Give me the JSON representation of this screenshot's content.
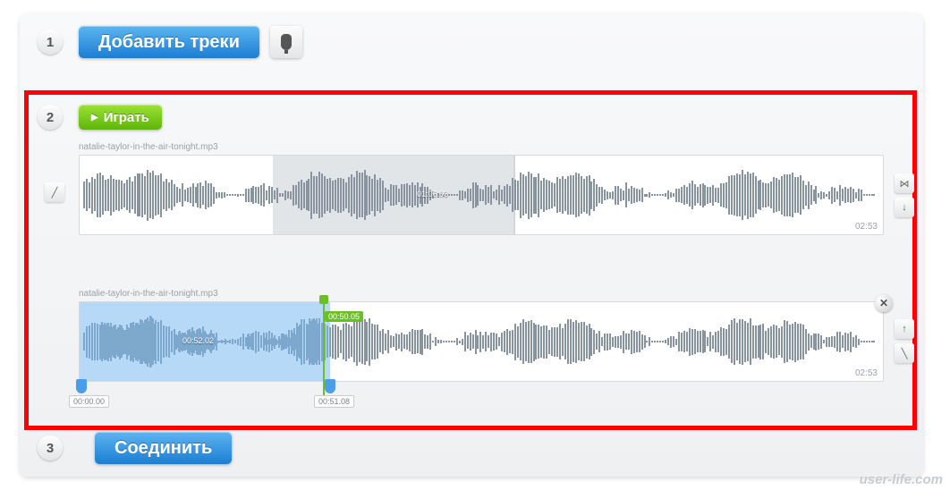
{
  "steps": {
    "s1": "1",
    "s2": "2",
    "s3": "3"
  },
  "buttons": {
    "add_tracks": "Добавить треки",
    "play": "Играть",
    "join": "Соединить"
  },
  "tracks": [
    {
      "filename": "natalie-taylor-in-the-air-tonight.mp3",
      "duration": "02:53",
      "midpoint_time": "01:06.03"
    },
    {
      "filename": "natalie-taylor-in-the-air-tonight.mp3",
      "duration": "02:53",
      "selection_time": "00:52.02",
      "cue_time": "00:50.05",
      "handle_start": "00:00.00",
      "handle_end": "00:51.08"
    }
  ],
  "watermark": "user-life.com"
}
